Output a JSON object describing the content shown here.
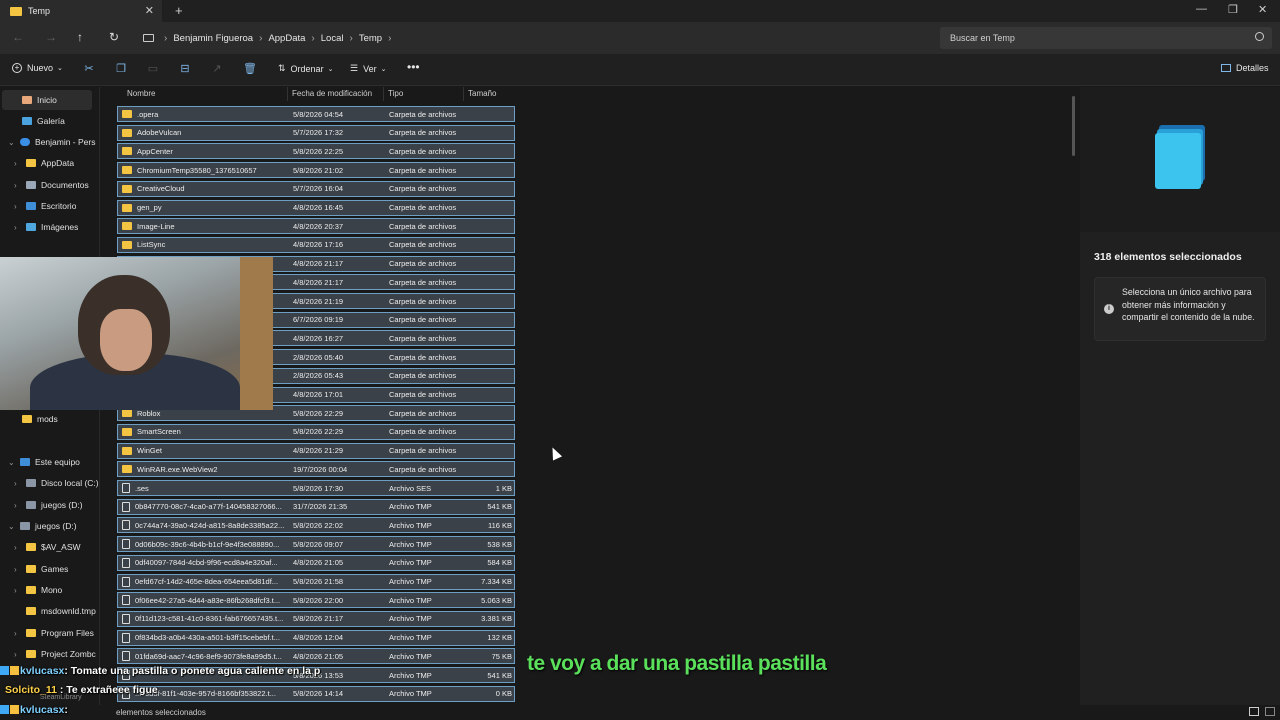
{
  "window": {
    "tab_title": "Temp"
  },
  "nav": {
    "crumbs": [
      "Benjamin Figueroa",
      "AppData",
      "Local",
      "Temp"
    ],
    "search_placeholder": "Buscar en Temp"
  },
  "toolbar": {
    "new_label": "Nuevo",
    "sort_label": "Ordenar",
    "view_label": "Ver",
    "details_label": "Detalles"
  },
  "sidebar": {
    "home": "Inicio",
    "gallery": "Galería",
    "onedrive": "Benjamin - Pers",
    "appdata": "AppData",
    "documents": "Documentos",
    "desktop": "Escritorio",
    "images": "Imágenes",
    "mods": "mods",
    "thispc": "Este equipo",
    "disk_c": "Disco local (C:)",
    "juegos1": "juegos (D:)",
    "juegos2": "juegos (D:)",
    "av": "$AV_ASW",
    "games": "Games",
    "mono": "Mono",
    "msdown": "msdownld.tmp",
    "progfiles": "Program Files",
    "zomboid": "Project Zombc",
    "steam": "SteamLibrary"
  },
  "columns": {
    "name": "Nombre",
    "date": "Fecha de modificación",
    "type": "Tipo",
    "size": "Tamaño"
  },
  "files": [
    {
      "name": ".opera",
      "date": "5/8/2026 04:54",
      "type": "Carpeta de archivos",
      "size": "",
      "kind": "folder"
    },
    {
      "name": "AdobeVulcan",
      "date": "5/7/2026 17:32",
      "type": "Carpeta de archivos",
      "size": "",
      "kind": "folder"
    },
    {
      "name": "AppCenter",
      "date": "5/8/2026 22:25",
      "type": "Carpeta de archivos",
      "size": "",
      "kind": "folder"
    },
    {
      "name": "ChromiumTemp35580_1376510657",
      "date": "5/8/2026 21:02",
      "type": "Carpeta de archivos",
      "size": "",
      "kind": "folder"
    },
    {
      "name": "CreativeCloud",
      "date": "5/7/2026 16:04",
      "type": "Carpeta de archivos",
      "size": "",
      "kind": "folder"
    },
    {
      "name": "gen_py",
      "date": "4/8/2026 16:45",
      "type": "Carpeta de archivos",
      "size": "",
      "kind": "folder"
    },
    {
      "name": "Image-Line",
      "date": "4/8/2026 20:37",
      "type": "Carpeta de archivos",
      "size": "",
      "kind": "folder"
    },
    {
      "name": "ListSync",
      "date": "4/8/2026 17:16",
      "type": "Carpeta de archivos",
      "size": "",
      "kind": "folder"
    },
    {
      "name": "",
      "date": "4/8/2026 21:17",
      "type": "Carpeta de archivos",
      "size": "",
      "kind": "folder"
    },
    {
      "name": "",
      "date": "4/8/2026 21:17",
      "type": "Carpeta de archivos",
      "size": "",
      "kind": "folder"
    },
    {
      "name": "",
      "date": "4/8/2026 21:19",
      "type": "Carpeta de archivos",
      "size": "",
      "kind": "folder"
    },
    {
      "name": "",
      "date": "6/7/2026 09:19",
      "type": "Carpeta de archivos",
      "size": "",
      "kind": "folder"
    },
    {
      "name": "",
      "date": "4/8/2026 16:27",
      "type": "Carpeta de archivos",
      "size": "",
      "kind": "folder"
    },
    {
      "name": "",
      "date": "2/8/2026 05:40",
      "type": "Carpeta de archivos",
      "size": "",
      "kind": "folder"
    },
    {
      "name": "",
      "date": "2/8/2026 05:43",
      "type": "Carpeta de archivos",
      "size": "",
      "kind": "folder"
    },
    {
      "name": "",
      "date": "4/8/2026 17:01",
      "type": "Carpeta de archivos",
      "size": "",
      "kind": "folder"
    },
    {
      "name": "Roblox",
      "date": "5/8/2026 22:29",
      "type": "Carpeta de archivos",
      "size": "",
      "kind": "folder"
    },
    {
      "name": "SmartScreen",
      "date": "5/8/2026 22:29",
      "type": "Carpeta de archivos",
      "size": "",
      "kind": "folder"
    },
    {
      "name": "WinGet",
      "date": "4/8/2026 21:29",
      "type": "Carpeta de archivos",
      "size": "",
      "kind": "folder"
    },
    {
      "name": "WinRAR.exe.WebView2",
      "date": "19/7/2026 00:04",
      "type": "Carpeta de archivos",
      "size": "",
      "kind": "folder"
    },
    {
      "name": ".ses",
      "date": "5/8/2026 17:30",
      "type": "Archivo SES",
      "size": "1 KB",
      "kind": "file"
    },
    {
      "name": "0b847770-08c7-4ca0-a77f-140458327066...",
      "date": "31/7/2026 21:35",
      "type": "Archivo TMP",
      "size": "541 KB",
      "kind": "file"
    },
    {
      "name": "0c744a74-39a0-424d-a815-8a8de3385a22...",
      "date": "5/8/2026 22:02",
      "type": "Archivo TMP",
      "size": "116 KB",
      "kind": "file"
    },
    {
      "name": "0d06b09c-39c6-4b4b-b1cf-9e4f3e088890...",
      "date": "5/8/2026 09:07",
      "type": "Archivo TMP",
      "size": "538 KB",
      "kind": "file"
    },
    {
      "name": "0df40097-784d-4cbd-9f96-ecd8a4e320af...",
      "date": "4/8/2026 21:05",
      "type": "Archivo TMP",
      "size": "584 KB",
      "kind": "file"
    },
    {
      "name": "0efd67cf-14d2-465e-8dea-654eea5d81df...",
      "date": "5/8/2026 21:58",
      "type": "Archivo TMP",
      "size": "7.334 KB",
      "kind": "file"
    },
    {
      "name": "0f06ee42-27a5-4d44-a83e-86fb268dfcf3.t...",
      "date": "5/8/2026 22:00",
      "type": "Archivo TMP",
      "size": "5.063 KB",
      "kind": "file"
    },
    {
      "name": "0f11d123-c581-41c0-8361-fab676657435.t...",
      "date": "5/8/2026 21:17",
      "type": "Archivo TMP",
      "size": "3.381 KB",
      "kind": "file"
    },
    {
      "name": "0f834bd3-a0b4-430a-a501-b3ff15cebebf.t...",
      "date": "4/8/2026 12:04",
      "type": "Archivo TMP",
      "size": "132 KB",
      "kind": "file"
    },
    {
      "name": "01fda69d-aac7-4c96-8ef9-9073fe8a99d5.t...",
      "date": "4/8/2026 21:05",
      "type": "Archivo TMP",
      "size": "75 KB",
      "kind": "file"
    },
    {
      "name": "",
      "date": "5/8/2026 13:53",
      "type": "Archivo TMP",
      "size": "541 KB",
      "kind": "file"
    },
    {
      "name": "...c3d3f-81f1-403e-957d-8166bf353822.t...",
      "date": "5/8/2026 14:14",
      "type": "Archivo TMP",
      "size": "0 KB",
      "kind": "file"
    }
  ],
  "details": {
    "title": "318 elementos seleccionados",
    "info": "Selecciona un único archivo para obtener más información y compartir el contenido de la nube."
  },
  "status": {
    "text": "elementos seleccionados"
  },
  "overlay": {
    "chat": [
      {
        "user": "kvlucasx",
        "msg": ": Tomate una pastilla o ponete agua caliente en la p"
      },
      {
        "user": "Solcito_11",
        "msg": " : Te extrañeee figue"
      },
      {
        "user": "kvlucasx",
        "msg": ":"
      }
    ],
    "caption": "te voy a dar una pastilla pastilla"
  },
  "colors": {
    "accent": "#6d9ec4",
    "folder": "#f4c542",
    "caption": "#5be05b"
  }
}
